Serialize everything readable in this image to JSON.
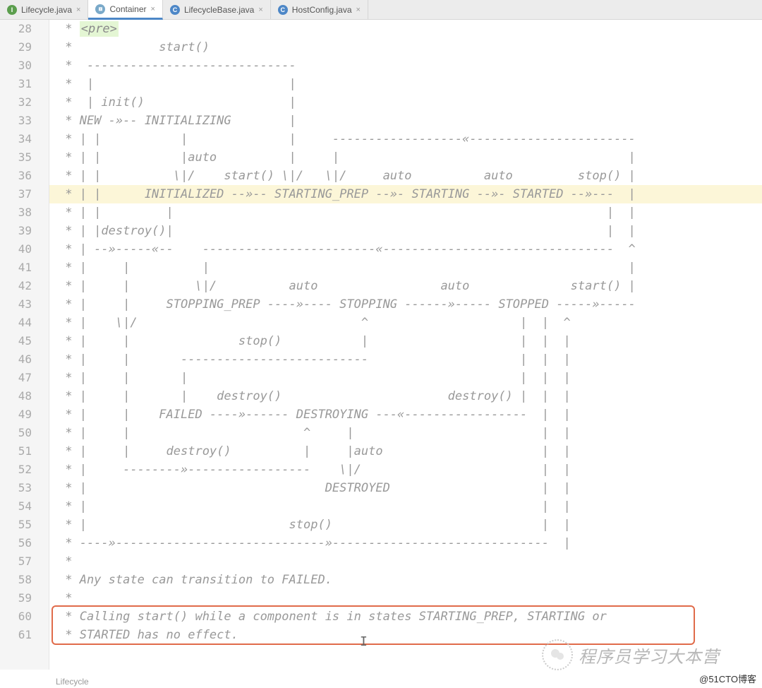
{
  "tabs": [
    {
      "label": "Lifecycle.java",
      "iconClass": "ic-i",
      "iconGlyph": "I",
      "active": false
    },
    {
      "label": "Container",
      "iconClass": "ic-int",
      "iconGlyph": "⧈",
      "active": true
    },
    {
      "label": "LifecycleBase.java",
      "iconClass": "ic-c",
      "iconGlyph": "C",
      "active": false
    },
    {
      "label": "HostConfig.java",
      "iconClass": "ic-c",
      "iconGlyph": "C",
      "active": false
    }
  ],
  "line_start": 28,
  "highlighted_line": 37,
  "pre_tag": "<pre>",
  "code_lines": [
    " * ",
    " *            start()",
    " *  -----------------------------",
    " *  |                           |",
    " *  | init()                    |",
    " * NEW -»-- INITIALIZING        |",
    " * | |           |              |     ------------------«-----------------------",
    " * | |           |auto          |     |                                        |",
    " * | |          \\|/    start() \\|/   \\|/     auto          auto         stop() |",
    " * | |      INITIALIZED --»-- STARTING_PREP --»- STARTING --»- STARTED --»---  |",
    " * | |         |                                                            |  |",
    " * | |destroy()|                                                            |  |",
    " * | --»-----«--    ------------------------«--------------------------------  ^",
    " * |     |          |                                                          |",
    " * |     |         \\|/          auto                 auto              start() |",
    " * |     |     STOPPING_PREP ----»---- STOPPING ------»----- STOPPED -----»-----",
    " * |    \\|/                               ^                     |  |  ^",
    " * |     |               stop()           |                     |  |  |",
    " * |     |       --------------------------                     |  |  |",
    " * |     |       |                                              |  |  |",
    " * |     |       |    destroy()                       destroy() |  |  |",
    " * |     |    FAILED ----»------ DESTROYING ---«-----------------  |  |",
    " * |     |                        ^     |                          |  |",
    " * |     |     destroy()          |     |auto                      |  |",
    " * |     --------»-----------------    \\|/                         |  |",
    " * |                                 DESTROYED                     |  |",
    " * |                                                               |  |",
    " * |                            stop()                             |  |",
    " * ----»-----------------------------»------------------------------  |",
    " *",
    " * Any state can transition to FAILED.",
    " *",
    " * Calling start() while a component is in states STARTING_PREP, STARTING or",
    " * STARTED has no effect."
  ],
  "breadcrumb": "Lifecycle",
  "watermark": "@51CTO博客",
  "wechat_text": "程序员学习大本营"
}
